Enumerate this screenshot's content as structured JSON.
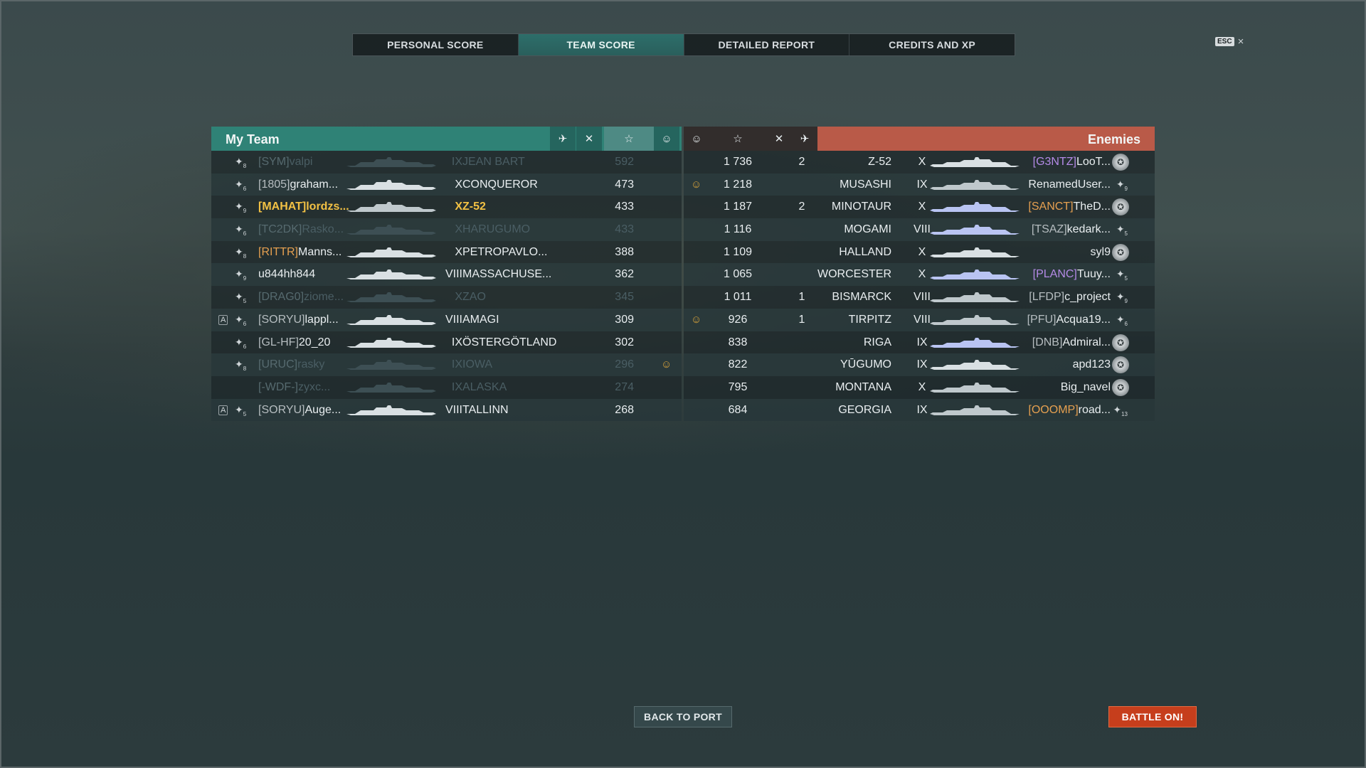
{
  "tabs": [
    {
      "label": "PERSONAL SCORE",
      "active": false
    },
    {
      "label": "TEAM SCORE",
      "active": true
    },
    {
      "label": "DETAILED REPORT",
      "active": false
    },
    {
      "label": "CREDITS AND XP",
      "active": false
    }
  ],
  "esc": {
    "key": "ESC",
    "close": "×"
  },
  "my_team": {
    "title": "My Team",
    "columns": [
      "plane-kills-icon",
      "kills-icon",
      "xp-star-icon",
      "achievement-icon"
    ],
    "players": [
      {
        "clan": "[SYM]",
        "name": "valpi",
        "tier": "IX",
        "ship": "JEAN BART",
        "xp": "592",
        "dead": true
      },
      {
        "clan": "[1805]",
        "name": "graham...",
        "tier": "X",
        "ship": "CONQUEROR",
        "xp": "473",
        "dead": false
      },
      {
        "clan": "[MAHAT]",
        "name": "lordzs...",
        "tier": "X",
        "ship": "Z-52",
        "xp": "433",
        "dead": false,
        "me": true
      },
      {
        "clan": "[TC2DK]",
        "name": "Rasko...",
        "tier": "X",
        "ship": "HARUGUMO",
        "xp": "433",
        "dead": true
      },
      {
        "clan": "[RITTR]",
        "name": "Manns...",
        "tier": "X",
        "ship": "PETROPAVLO...",
        "xp": "388",
        "dead": false
      },
      {
        "clan": "",
        "name": "u844hh844",
        "tier": "VIII",
        "ship": "MASSACHUSE...",
        "xp": "362",
        "dead": false
      },
      {
        "clan": "[DRAG0]",
        "name": "ziome...",
        "tier": "X",
        "ship": "ZAO",
        "xp": "345",
        "dead": true
      },
      {
        "clan": "[SORYU]",
        "name": "lappl...",
        "tier": "VIII",
        "ship": "AMAGI",
        "xp": "309",
        "dead": false
      },
      {
        "clan": "[GL-HF]",
        "name": "20_20",
        "tier": "IX",
        "ship": "ÖSTERGÖTLAND",
        "xp": "302",
        "dead": false
      },
      {
        "clan": "[URUC]",
        "name": "rasky",
        "tier": "IX",
        "ship": "IOWA",
        "xp": "296",
        "dead": true
      },
      {
        "clan": "[-WDF-]",
        "name": "zyxc...",
        "tier": "IX",
        "ship": "ALASKA",
        "xp": "274",
        "dead": true
      },
      {
        "clan": "[SORYU]",
        "name": "Auge...",
        "tier": "VIII",
        "ship": "TALLINN",
        "xp": "268",
        "dead": false
      }
    ]
  },
  "enemies": {
    "title": "Enemies",
    "players": [
      {
        "xp": "1 736",
        "kills": "2",
        "ship": "Z-52",
        "tier": "X",
        "clan": "[G3NTZ]",
        "name": "LooT..."
      },
      {
        "xp": "1 218",
        "kills": "",
        "ship": "MUSASHI",
        "tier": "IX",
        "clan": "",
        "name": "RenamedUser..."
      },
      {
        "xp": "1 187",
        "kills": "2",
        "ship": "MINOTAUR",
        "tier": "X",
        "clan": "[SANCT]",
        "name": "TheD..."
      },
      {
        "xp": "1 116",
        "kills": "",
        "ship": "MOGAMI",
        "tier": "VIII",
        "clan": "[TSAZ]",
        "name": "kedark..."
      },
      {
        "xp": "1 109",
        "kills": "",
        "ship": "HALLAND",
        "tier": "X",
        "clan": "",
        "name": "syl9"
      },
      {
        "xp": "1 065",
        "kills": "",
        "ship": "WORCESTER",
        "tier": "X",
        "clan": "[PLANC]",
        "name": "Tuuy..."
      },
      {
        "xp": "1 011",
        "kills": "1",
        "ship": "BISMARCK",
        "tier": "VIII",
        "clan": "[LFDP]",
        "name": "c_project"
      },
      {
        "xp": "926",
        "kills": "1",
        "ship": "TIRPITZ",
        "tier": "VIII",
        "clan": "[PFU]",
        "name": "Acqua19..."
      },
      {
        "xp": "838",
        "kills": "",
        "ship": "RIGA",
        "tier": "IX",
        "clan": "[DNB]",
        "name": "Admiral..."
      },
      {
        "xp": "822",
        "kills": "",
        "ship": "YŪGUMO",
        "tier": "IX",
        "clan": "",
        "name": "apd123"
      },
      {
        "xp": "795",
        "kills": "",
        "ship": "MONTANA",
        "tier": "X",
        "clan": "",
        "name": "Big_navel"
      },
      {
        "xp": "684",
        "kills": "",
        "ship": "GEORGIA",
        "tier": "IX",
        "clan": "[OOOMP]",
        "name": "road..."
      }
    ]
  },
  "ranks": {
    "r8": "8",
    "r9": "9",
    "r5": "5",
    "r6": "6",
    "r13": "13"
  },
  "buttons": {
    "back": "BACK TO PORT",
    "battle": "BATTLE ON!"
  },
  "colors": {
    "my_team": "#2f8276",
    "enemies": "#b95a48",
    "battle_button": "#c63e1c",
    "my_name": "#f2c144"
  }
}
